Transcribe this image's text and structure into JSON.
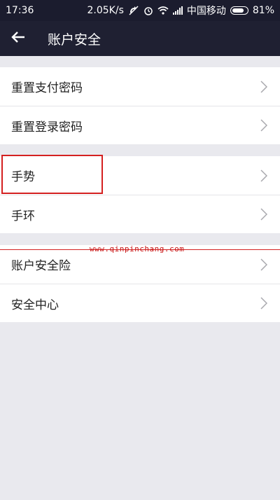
{
  "status_bar": {
    "time": "17:36",
    "network_speed": "2.05K/s",
    "carrier": "中国移动",
    "battery": "81%",
    "battery_level": 0.81
  },
  "header": {
    "title": "账户安全",
    "back_icon": "arrow-left-icon"
  },
  "groups": [
    {
      "items": [
        {
          "label": "重置支付密码"
        },
        {
          "label": "重置登录密码"
        }
      ]
    },
    {
      "items": [
        {
          "label": "手势"
        },
        {
          "label": "手环"
        }
      ]
    },
    {
      "items": [
        {
          "label": "账户安全险"
        },
        {
          "label": "安全中心"
        }
      ]
    }
  ],
  "annotation": {
    "watermark": "www.qinpinchang.com",
    "highlight_color": "#d42020"
  },
  "colors": {
    "header_bg": "#1f2032",
    "page_bg": "#e9e9ee",
    "row_bg": "#ffffff",
    "chevron": "#a8a8ad"
  }
}
